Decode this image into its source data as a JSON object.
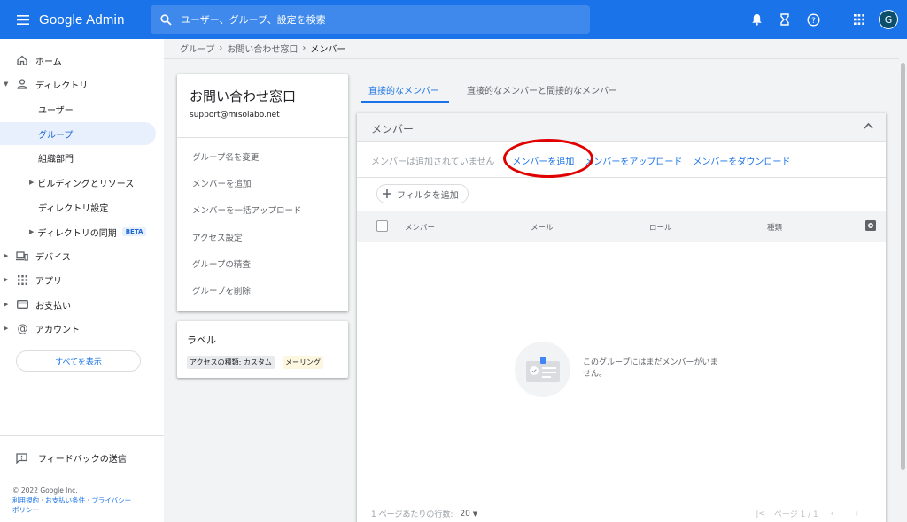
{
  "app": {
    "title": "Google Admin",
    "avatar_letter": "G"
  },
  "search": {
    "placeholder": "ユーザー、グループ、設定を検索"
  },
  "sidebar": {
    "items": [
      {
        "label": "ホーム"
      },
      {
        "label": "ディレクトリ"
      },
      {
        "label": "ユーザー"
      },
      {
        "label": "グループ"
      },
      {
        "label": "組織部門"
      },
      {
        "label": "ビルディングとリソース"
      },
      {
        "label": "ディレクトリ設定"
      },
      {
        "label": "ディレクトリの同期",
        "badge": "BETA"
      },
      {
        "label": "デバイス"
      },
      {
        "label": "アプリ"
      },
      {
        "label": "お支払い"
      },
      {
        "label": "アカウント"
      }
    ],
    "show_all": "すべてを表示",
    "feedback": "フィードバックの送信",
    "copyright": "© 2022 Google Inc.",
    "links": [
      "利用規約",
      "お支払い条件",
      "プライバシー",
      "ポリシー"
    ]
  },
  "breadcrumb": [
    "グループ",
    "お問い合わせ窓口",
    "メンバー"
  ],
  "group": {
    "name": "お問い合わせ窓口",
    "email": "support@misolabo.net",
    "actions": [
      "グループ名を変更",
      "メンバーを追加",
      "メンバーを一括アップロード",
      "アクセス設定",
      "グループの精査",
      "グループを削除"
    ]
  },
  "labels": {
    "title": "ラベル",
    "chips": [
      "アクセスの種類: カスタム",
      "メーリング"
    ]
  },
  "tabs": [
    "直接的なメンバー",
    "直接的なメンバーと間接的なメンバー"
  ],
  "members": {
    "title": "メンバー",
    "none_text": "メンバーは追加されていません",
    "add": "メンバーを追加",
    "upload": "メンバーをアップロード",
    "download": "メンバーをダウンロード",
    "filter": "フィルタを追加",
    "columns": [
      "メンバー",
      "メール",
      "ロール",
      "種類"
    ],
    "empty_line1": "このグループにはまだメンバーがいま",
    "empty_line2": "せん。",
    "rows_per_page_label": "1 ページあたりの行数:",
    "rows_per_page": "20",
    "page_label": "ページ 1 / 1"
  },
  "colors": {
    "primary": "#1a73e8",
    "highlight_ring": "#e00000"
  }
}
